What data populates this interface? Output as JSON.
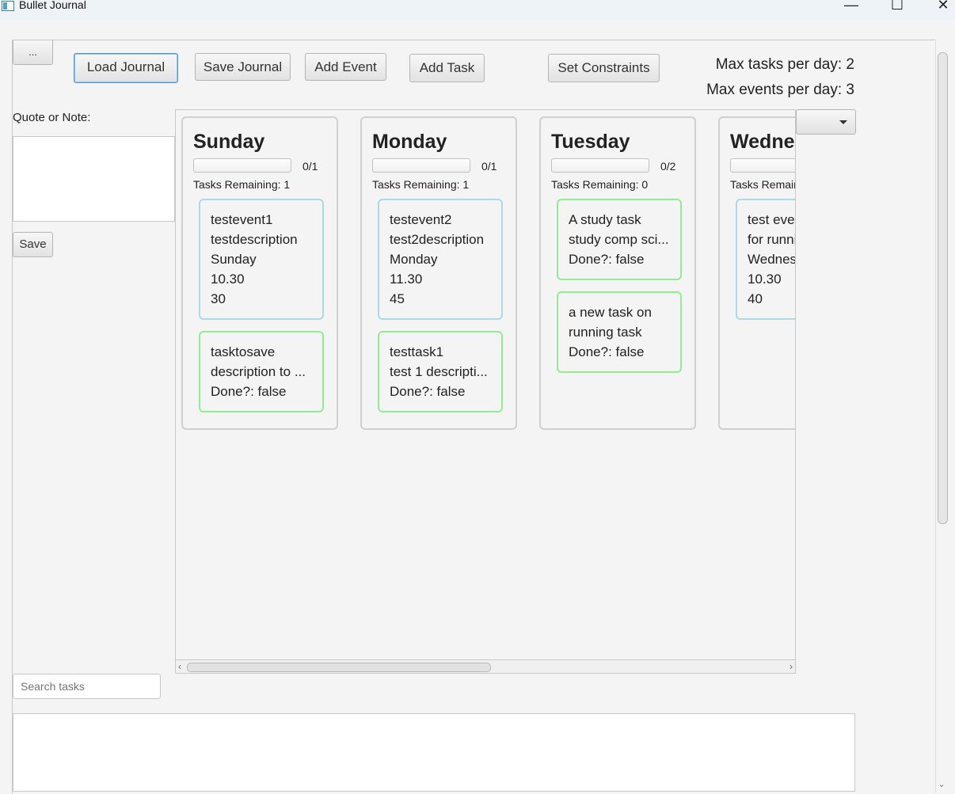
{
  "window": {
    "title": "Bullet Journal",
    "minimize_glyph": "—",
    "maximize_glyph": "☐",
    "close_glyph": "✕"
  },
  "toolbar": {
    "menu_label": "...",
    "load_label": "Load Journal",
    "save_label": "Save Journal",
    "add_event_label": "Add Event",
    "add_task_label": "Add Task",
    "set_constraints_label": "Set Constraints"
  },
  "constraints": {
    "max_tasks": "Max tasks per day: 2",
    "max_events": "Max events per day: 3"
  },
  "note": {
    "label": "Quote or Note:",
    "value": "",
    "save_label": "Save"
  },
  "days": [
    {
      "name": "Sunday",
      "ratio": "0/1",
      "progress": 0,
      "remaining": "Tasks Remaining: 1",
      "events": [
        [
          "testevent1",
          "testdescription",
          "Sunday",
          "10.30",
          "30"
        ]
      ],
      "tasks": [
        [
          "tasktosave",
          "description to ...",
          "Done?: false"
        ]
      ]
    },
    {
      "name": "Monday",
      "ratio": "0/1",
      "progress": 0,
      "remaining": "Tasks Remaining: 1",
      "events": [
        [
          "testevent2",
          "test2description",
          "Monday",
          "11.30",
          "45"
        ]
      ],
      "tasks": [
        [
          "testtask1",
          "test 1 descripti...",
          "Done?: false"
        ]
      ]
    },
    {
      "name": "Tuesday",
      "ratio": "0/2",
      "progress": 0,
      "remaining": "Tasks Remaining: 0",
      "events": [],
      "tasks": [
        [
          "A study task",
          "study comp sci...",
          "Done?: false"
        ],
        [
          "a new task on",
          "running task",
          "Done?: false"
        ]
      ]
    },
    {
      "name": "Wednesday",
      "ratio": "",
      "progress": 0,
      "remaining": "Tasks Remaining",
      "events": [
        [
          "test event",
          "for running",
          "Wednesday",
          "10.30",
          "40"
        ]
      ],
      "tasks": []
    }
  ],
  "dropdown": {
    "value": ""
  },
  "search": {
    "placeholder": "Search tasks",
    "value": ""
  },
  "results": {
    "value": ""
  },
  "colors": {
    "event_border": "#add8e6",
    "task_border": "#90ee90",
    "focus": "#4a9bd8"
  }
}
